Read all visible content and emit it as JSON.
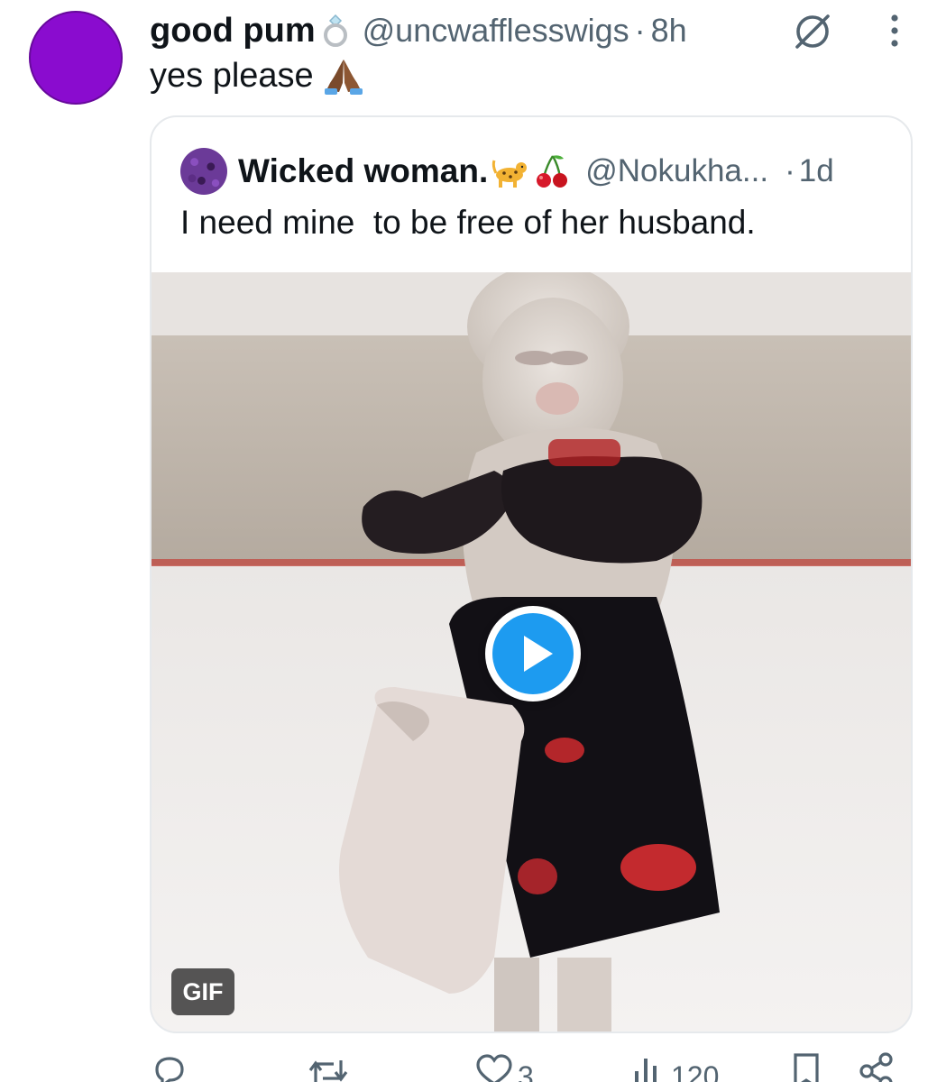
{
  "reply": {
    "display_name": "good pum",
    "handle": "@uncwafflesswigs",
    "separator": "·",
    "time": "8h",
    "text": "yes please",
    "avatar_color": "#8a0ccf"
  },
  "quote": {
    "display_name": "Wicked woman.",
    "handle": "@Nokukha...",
    "separator": "·",
    "time": "1d",
    "text": "I need mine  to be free of her husband.",
    "media_badge": "GIF"
  },
  "actions": {
    "reply_count": "",
    "repost_count": "",
    "like_count": "3",
    "views_count": "120"
  },
  "colors": {
    "text_primary": "#0f1419",
    "text_secondary": "#536471",
    "accent_blue": "#1d9bf0",
    "border": "#e6e9ec"
  },
  "icons": [
    "ring-emoji-icon",
    "folded-hands-emoji-icon",
    "leopard-emoji-icon",
    "cherries-emoji-icon",
    "grok-icon",
    "more-options-icon",
    "play-icon",
    "reply-icon",
    "repost-icon",
    "like-icon",
    "views-icon",
    "bookmark-icon",
    "share-icon"
  ]
}
